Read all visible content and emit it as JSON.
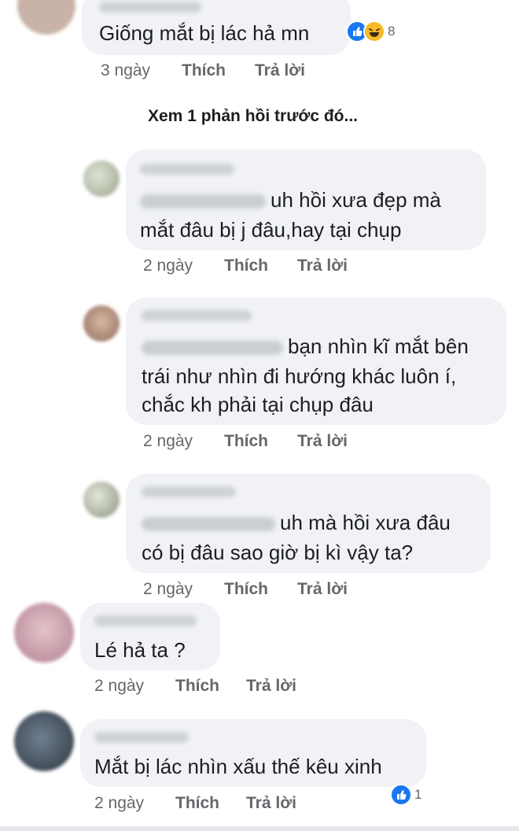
{
  "view_previous": "Xem 1 phản hồi trước đó...",
  "labels": {
    "like": "Thích",
    "reply": "Trả lời"
  },
  "comments": [
    {
      "text": [
        "Giống mắt bị lác hả mn"
      ],
      "time": "3 ngày",
      "reaction_count": "8"
    },
    {
      "text": [
        "uh hồi xưa đẹp mà",
        "mắt đâu bị j đâu,hay tại chụp"
      ],
      "time": "2 ngày"
    },
    {
      "text": [
        "bạn nhìn kĩ mắt bên",
        "trái như nhìn đi hướng khác luôn í,",
        "chắc kh phải tại chụp đâu"
      ],
      "time": "2 ngày"
    },
    {
      "text": [
        "uh mà hồi xưa đâu",
        "có bị đâu sao giờ bị kì vậy ta?"
      ],
      "time": "2 ngày"
    },
    {
      "text": [
        "Lé hả ta ?"
      ],
      "time": "2 ngày"
    },
    {
      "text": [
        "Mắt bị lác nhìn xấu thế kêu xinh"
      ],
      "time": "2 ngày",
      "reaction_count": "1"
    }
  ],
  "colors": {
    "bubble": "#f0f2f5",
    "meta": "#65676b",
    "like_blue": "#1877f2",
    "haha_yellow": "#f7b928"
  }
}
